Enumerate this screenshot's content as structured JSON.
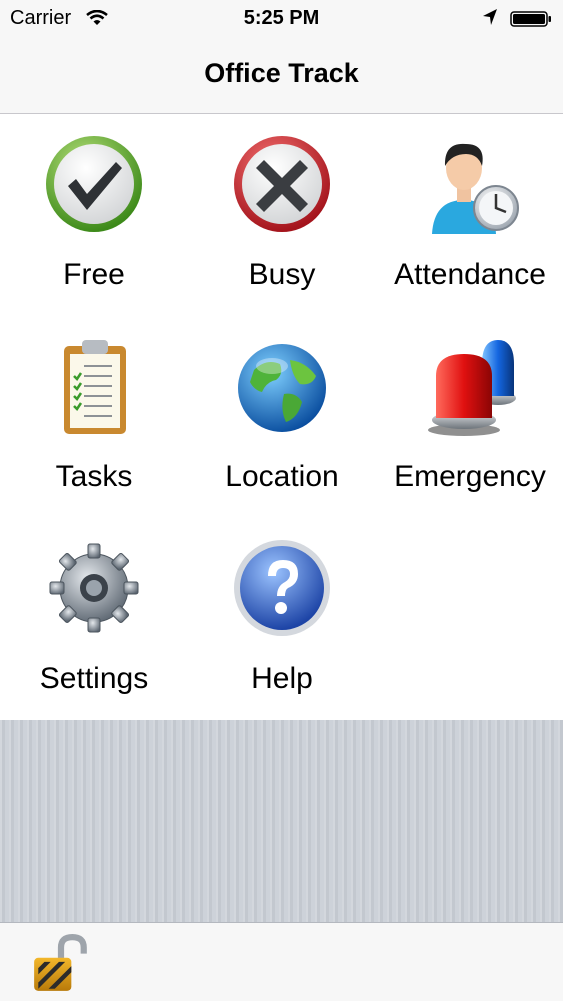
{
  "status_bar": {
    "carrier": "Carrier",
    "time": "5:25 PM",
    "icons": [
      "wifi-icon",
      "location-arrow-icon",
      "battery-icon"
    ]
  },
  "nav": {
    "title": "Office Track"
  },
  "tiles": [
    {
      "label": "Free",
      "icon": "green-checkmark-icon"
    },
    {
      "label": "Busy",
      "icon": "red-x-icon"
    },
    {
      "label": "Attendance",
      "icon": "person-clock-icon"
    },
    {
      "label": "Tasks",
      "icon": "clipboard-checklist-icon"
    },
    {
      "label": "Location",
      "icon": "globe-icon"
    },
    {
      "label": "Emergency",
      "icon": "siren-lights-icon"
    },
    {
      "label": "Settings",
      "icon": "gear-icon"
    },
    {
      "label": "Help",
      "icon": "question-mark-icon"
    }
  ],
  "toolbar": {
    "icons": [
      "open-padlock-icon"
    ]
  },
  "colors": {
    "nav_background": "#f7f7f7",
    "stripe_background": "#c9ced6",
    "free_green": "#5aa52a",
    "busy_red": "#c8202a",
    "help_blue": "#3a66c4"
  }
}
